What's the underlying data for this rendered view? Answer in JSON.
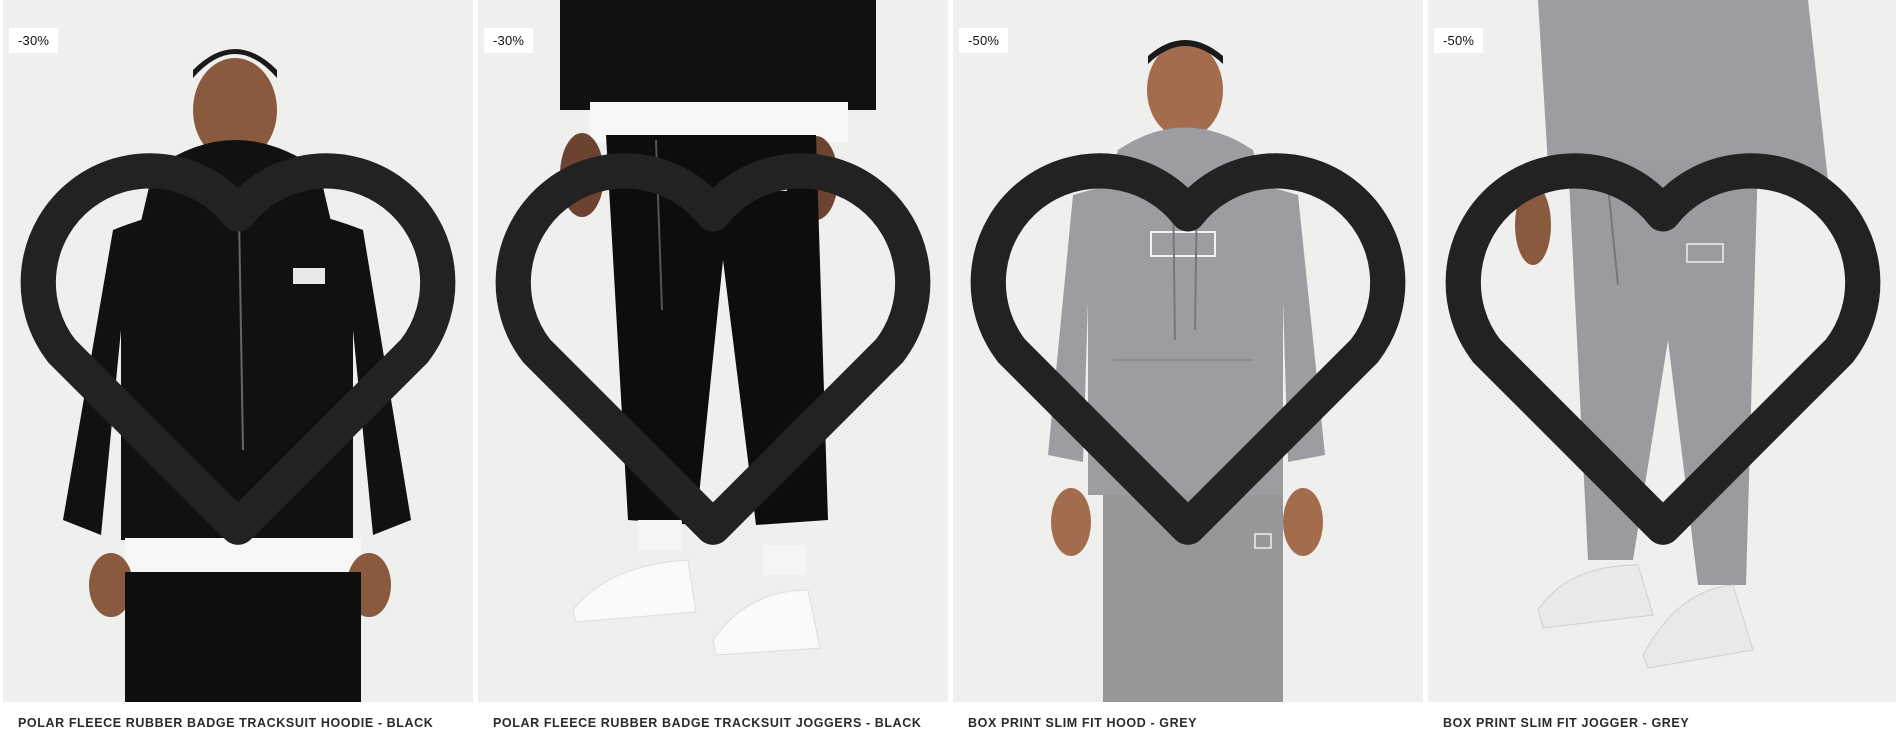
{
  "products": [
    {
      "discount": "-30%",
      "title": "POLAR FLEECE RUBBER BADGE TRACKSUIT HOODIE - BLACK",
      "image_subject": "model-black-hoodie",
      "wishlist_icon": "heart-outline-icon"
    },
    {
      "discount": "-30%",
      "title": "POLAR FLEECE RUBBER BADGE TRACKSUIT JOGGERS - BLACK",
      "image_subject": "model-black-joggers",
      "wishlist_icon": "heart-outline-icon"
    },
    {
      "discount": "-50%",
      "title": "BOX PRINT SLIM FIT HOOD - GREY",
      "image_subject": "model-grey-hood",
      "wishlist_icon": "heart-outline-icon"
    },
    {
      "discount": "-50%",
      "title": "BOX PRINT SLIM FIT JOGGER - GREY",
      "image_subject": "model-grey-jogger",
      "wishlist_icon": "heart-outline-icon"
    }
  ],
  "colors": {
    "image_background": "#efefed",
    "badge_background": "#ffffff",
    "black_garment": "#111111",
    "grey_garment": "#9b9da0",
    "skin": "#8a5a3e"
  }
}
